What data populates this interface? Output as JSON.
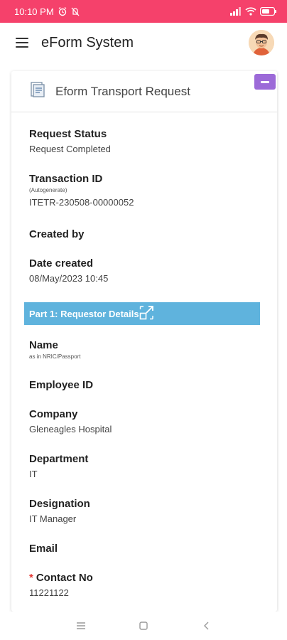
{
  "status_bar": {
    "time": "10:10 PM"
  },
  "app_bar": {
    "title": "eForm System"
  },
  "card": {
    "title": "Eform Transport Request",
    "fields": {
      "request_status": {
        "label": "Request Status",
        "value": "Request Completed"
      },
      "transaction_id": {
        "label": "Transaction ID",
        "sub": "(Autogenerate)",
        "value": "ITETR-230508-00000052"
      },
      "created_by": {
        "label": "Created by"
      },
      "date_created": {
        "label": "Date created",
        "value": "08/May/2023 10:45"
      },
      "name": {
        "label": "Name",
        "sub": "as in NRIC/Passport"
      },
      "employee_id": {
        "label": "Employee ID"
      },
      "company": {
        "label": "Company",
        "value": "Gleneagles Hospital"
      },
      "department": {
        "label": "Department",
        "value": "IT"
      },
      "designation": {
        "label": "Designation",
        "value": "IT Manager"
      },
      "email": {
        "label": "Email"
      },
      "contact_no": {
        "required_mark": "*",
        "label": "Contact No",
        "value": "11221122"
      }
    },
    "section": {
      "title": "Part 1: Requestor Details"
    }
  },
  "colors": {
    "status_bar": "#f5416b",
    "section_bar": "#5fb3dd",
    "collapse_button": "#9c6ad8",
    "required": "#e53935"
  },
  "icons": [
    "alarm-icon",
    "mute-icon",
    "signal-icon",
    "wifi-icon",
    "battery-icon",
    "menu-icon",
    "avatar",
    "document-icon",
    "collapse-icon",
    "expand-icon",
    "nav-menu-icon",
    "nav-home-icon",
    "nav-back-icon"
  ]
}
